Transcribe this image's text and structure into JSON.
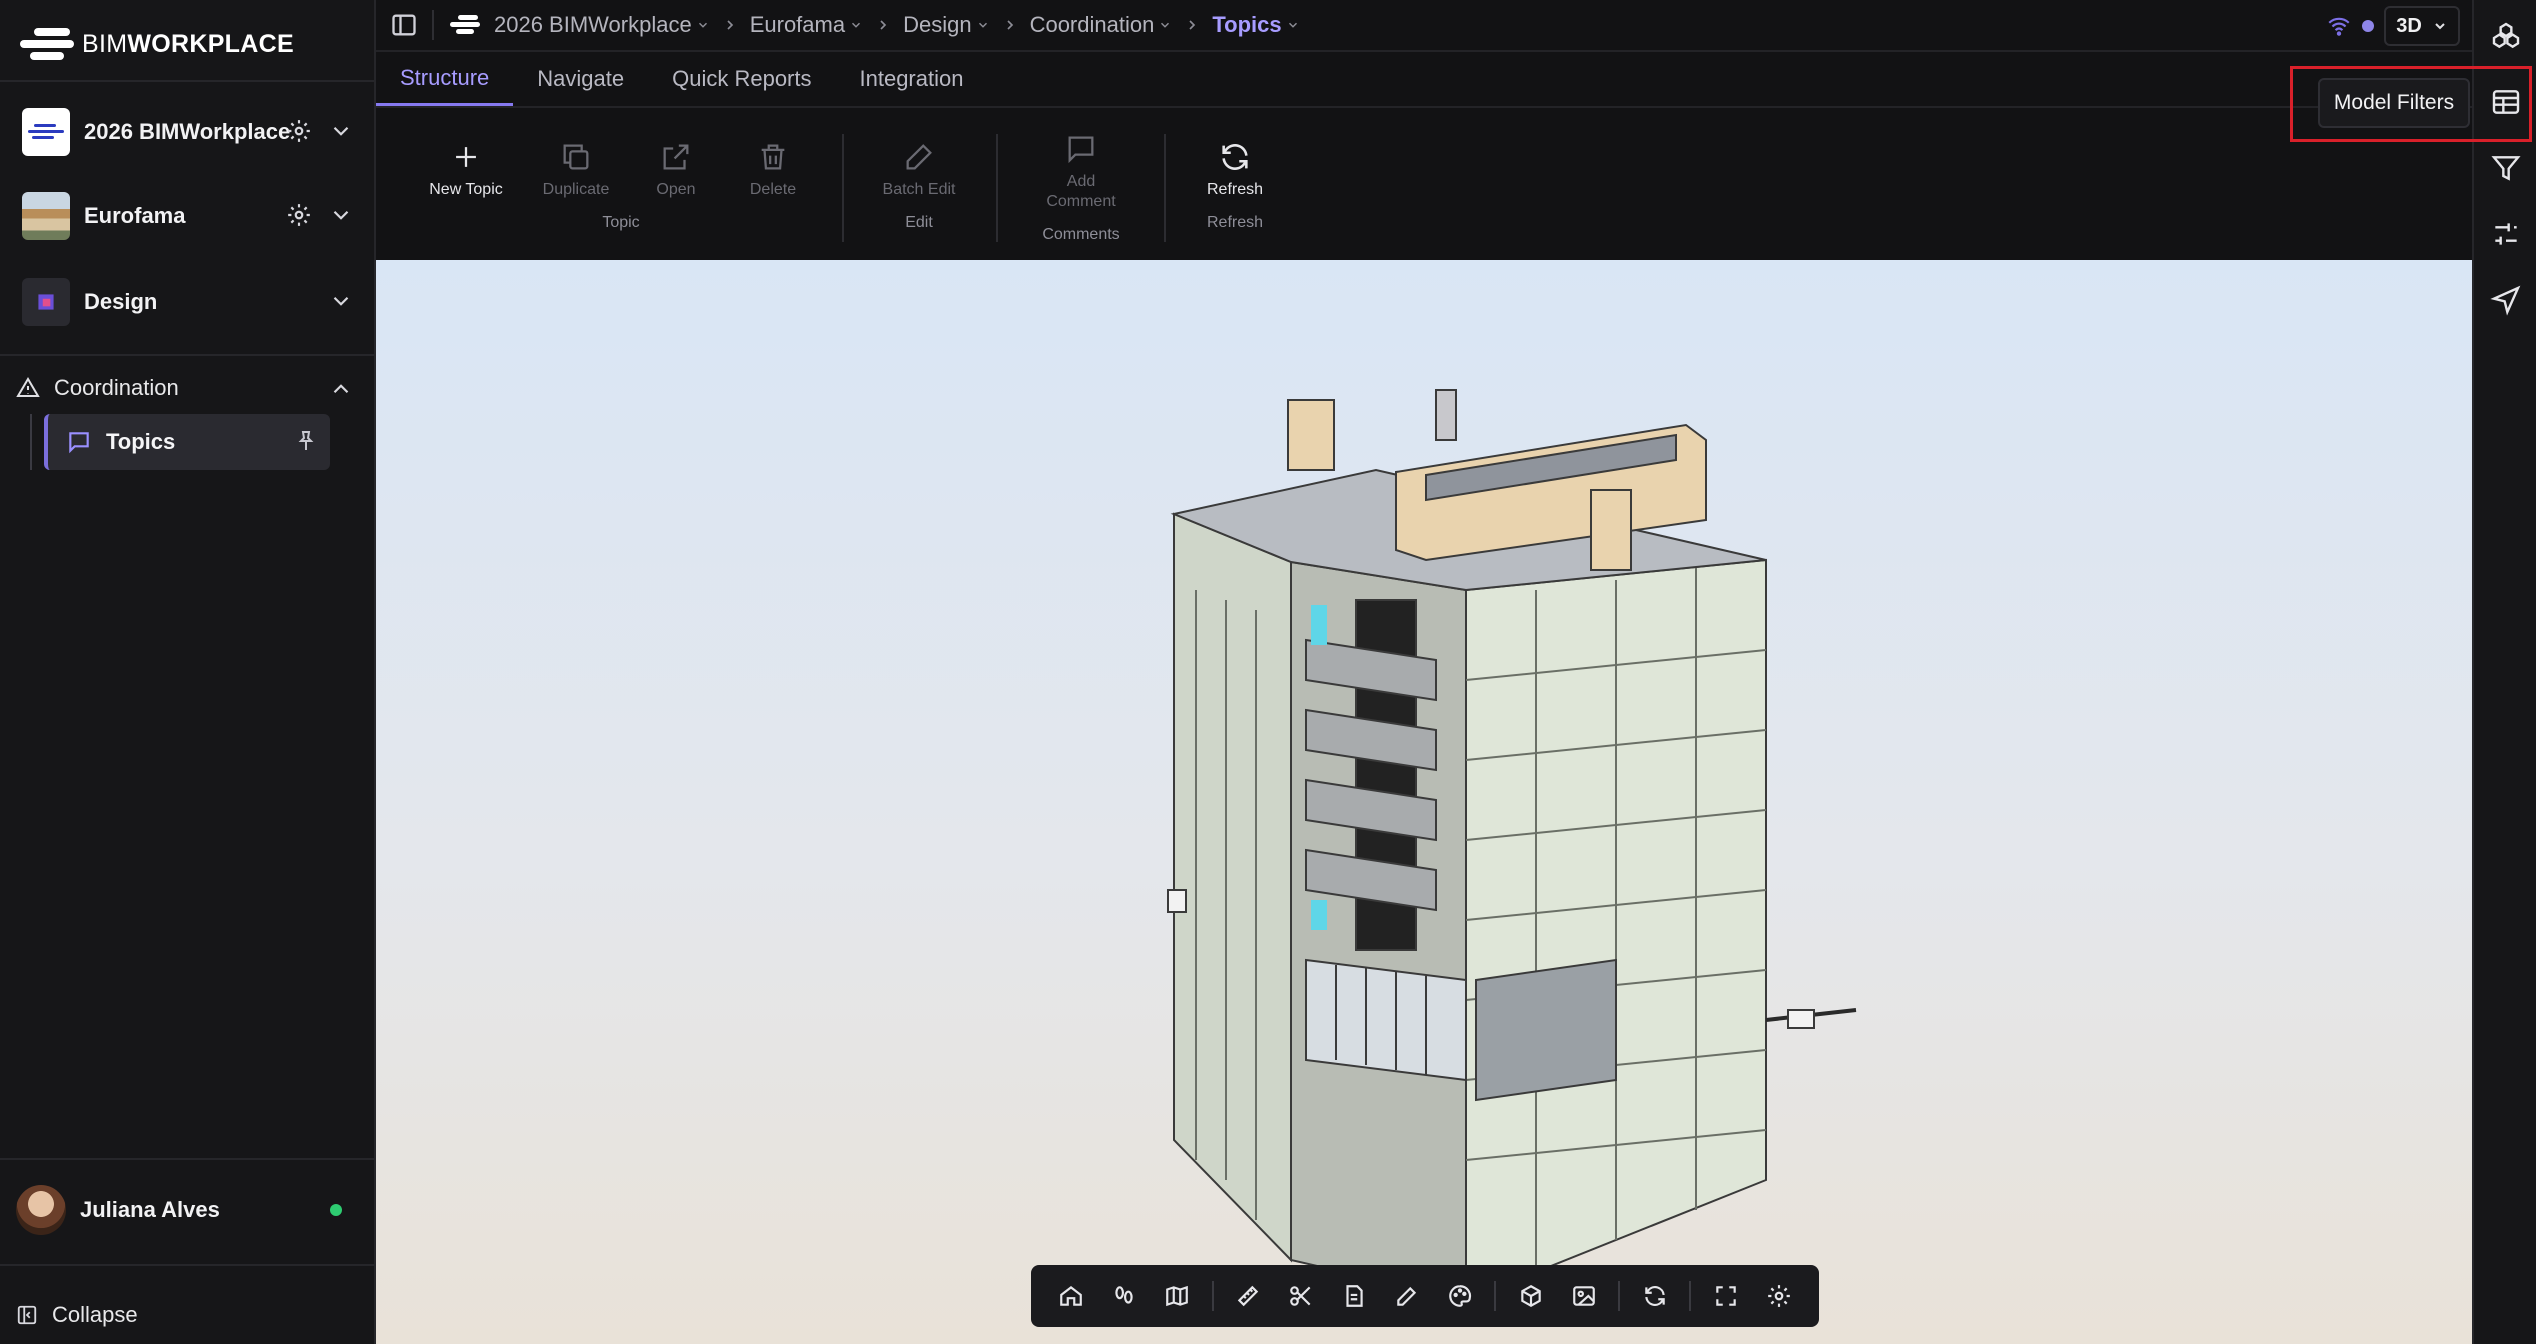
{
  "app": {
    "logo_prefix": "BIM",
    "logo_suffix": "WORKPLACE"
  },
  "sidebar": {
    "projects": [
      {
        "name": "2026 BIMWorkplace",
        "thumb": "bimworkplace-logo"
      },
      {
        "name": "Eurofama",
        "thumb": "building-photo"
      },
      {
        "name": "Design",
        "thumb": "design-icon"
      }
    ],
    "section": {
      "label": "Coordination",
      "icon": "warning-triangle-icon"
    },
    "active_item": {
      "label": "Topics",
      "icon": "chat-bubble-icon"
    },
    "user": {
      "name": "Juliana Alves",
      "status_color": "#2ecc71"
    },
    "collapse_label": "Collapse"
  },
  "breadcrumb": {
    "items": [
      "2026 BIMWorkplace",
      "Eurofama",
      "Design",
      "Coordination",
      "Topics"
    ]
  },
  "view_mode": "3D",
  "tabs": [
    "Structure",
    "Navigate",
    "Quick Reports",
    "Integration"
  ],
  "ribbon": {
    "buttons": {
      "new_topic": "New Topic",
      "duplicate": "Duplicate",
      "open": "Open",
      "delete": "Delete",
      "batch_edit": "Batch Edit",
      "add_comment_1": "Add",
      "add_comment_2": "Comment",
      "refresh": "Refresh"
    },
    "groups": {
      "topic": "Topic",
      "edit": "Edit",
      "comments": "Comments",
      "refresh": "Refresh"
    }
  },
  "tooltip": "Model Filters",
  "colors": {
    "accent": "#8679f0",
    "highlight": "#d9202a"
  }
}
